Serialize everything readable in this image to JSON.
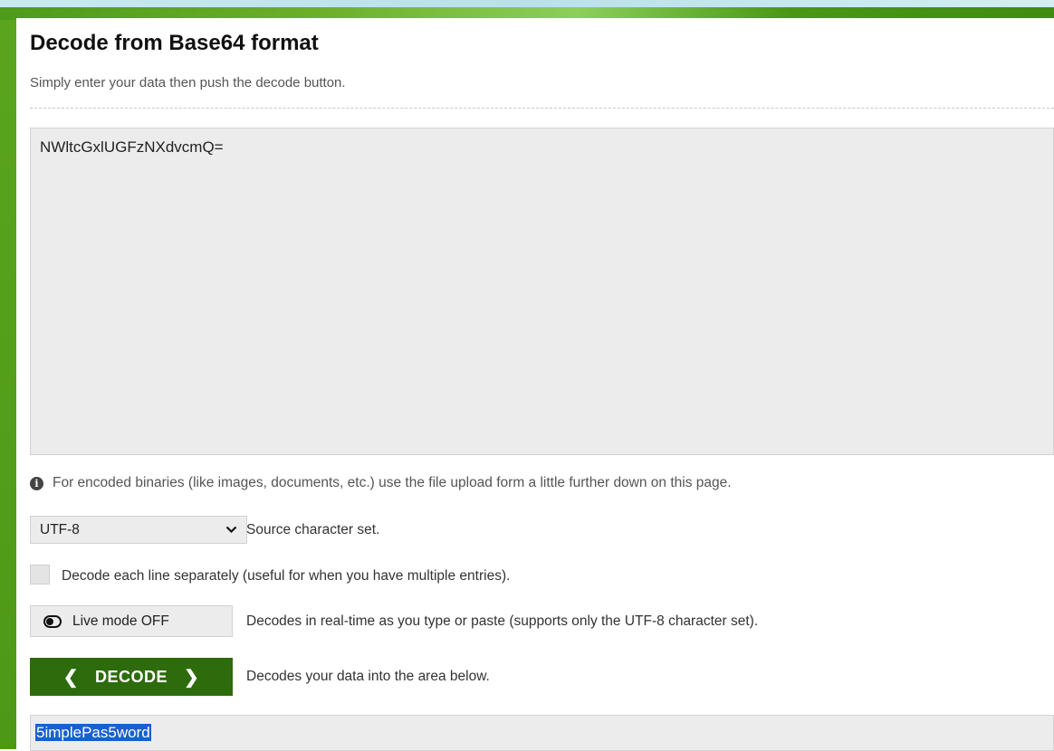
{
  "header": {
    "title": "Decode from Base64 format",
    "subtitle": "Simply enter your data then push the decode button."
  },
  "input": {
    "value": "NWltcGxlUGFzNXdvcmQ="
  },
  "info": {
    "text": "For encoded binaries (like images, documents, etc.) use the file upload form a little further down on this page.",
    "icon": "info-icon"
  },
  "charset": {
    "selected": "UTF-8",
    "label": "Source character set."
  },
  "separate_lines": {
    "checked": false,
    "label": "Decode each line separately (useful for when you have multiple entries)."
  },
  "live_mode": {
    "button_label": "Live mode OFF",
    "description": "Decodes in real-time as you type or paste (supports only the UTF-8 character set).",
    "icon": "toggle-off-icon"
  },
  "decode": {
    "button_label": "DECODE",
    "description": "Decodes your data into the area below."
  },
  "output": {
    "value": "5implePas5word",
    "selected": true
  },
  "colors": {
    "accent_green": "#2d6b0c",
    "rail_green": "#5aa51d",
    "selection_blue": "#1a5fcf"
  }
}
